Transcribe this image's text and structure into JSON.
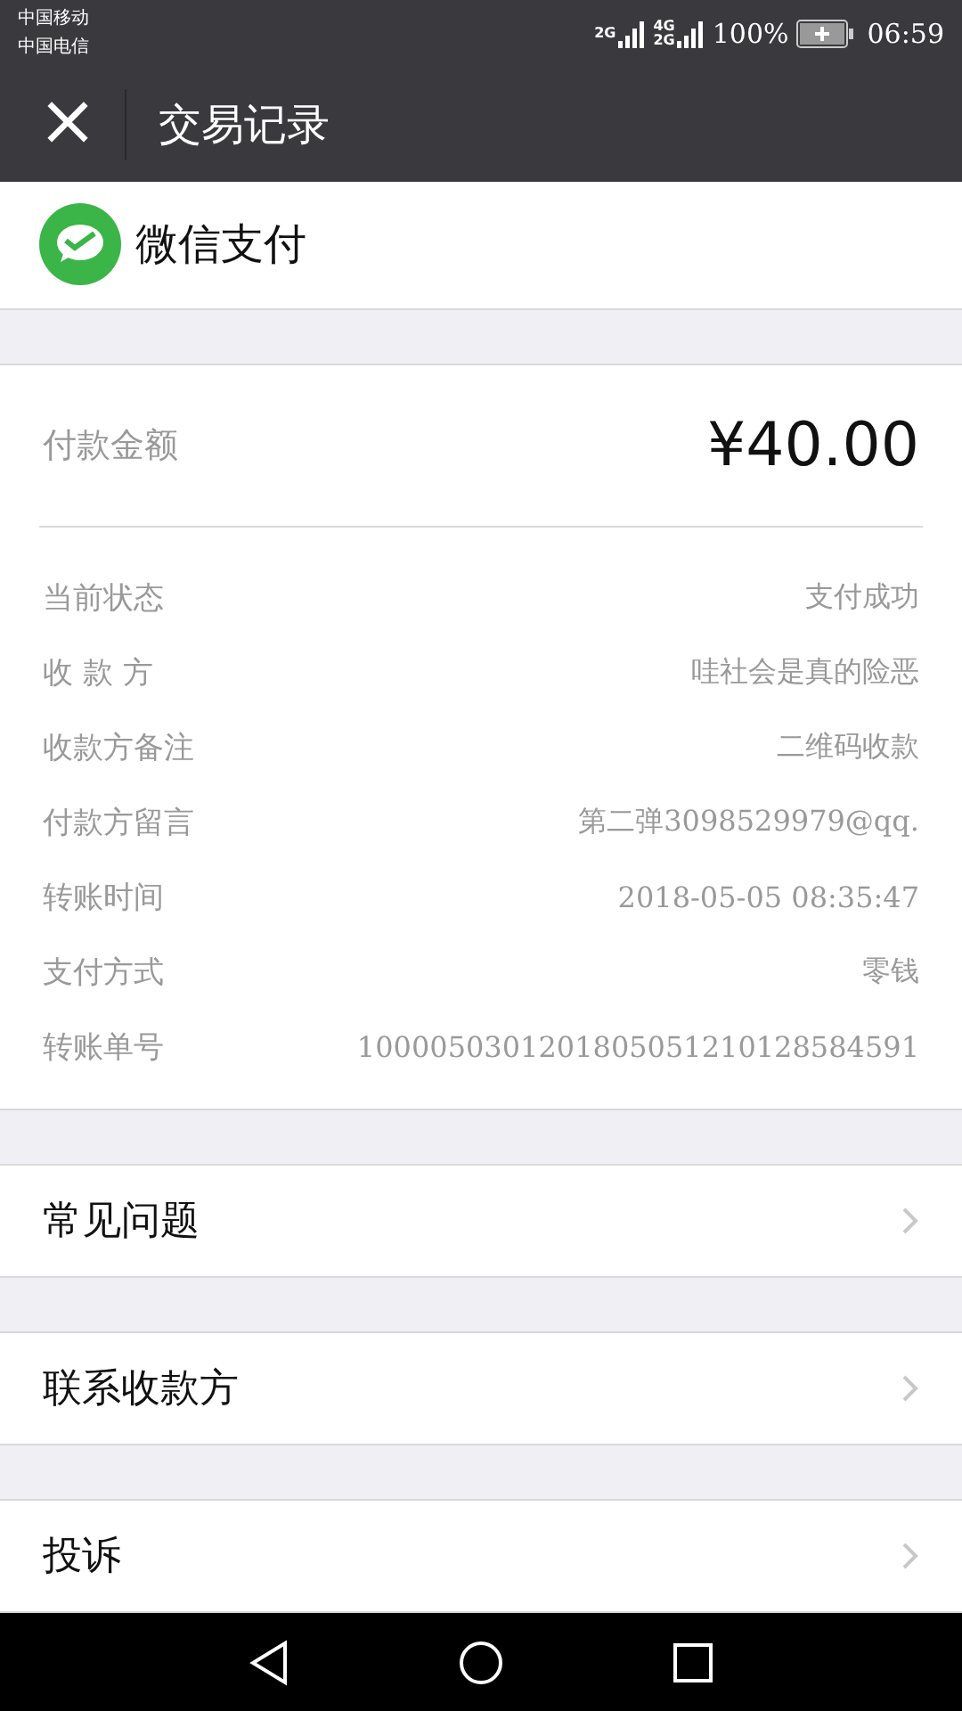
{
  "status_bar": {
    "carriers": [
      "中国移动",
      "中国电信"
    ],
    "signals": [
      {
        "labels": [
          "2G"
        ]
      },
      {
        "labels": [
          "4G",
          "2G"
        ]
      }
    ],
    "battery": "100%",
    "time": "06:59"
  },
  "header": {
    "close": "×",
    "title": "交易记录"
  },
  "brand": {
    "name": "微信支付"
  },
  "payment": {
    "amount_label": "付款金额",
    "amount": "¥40.00",
    "details": [
      {
        "label": "当前状态",
        "value": "支付成功"
      },
      {
        "label": "收 款 方",
        "value": "哇社会是真的险恶"
      },
      {
        "label": "收款方备注",
        "value": "二维码收款"
      },
      {
        "label": "付款方留言",
        "value": "第二弹3098529979@qq."
      },
      {
        "label": "转账时间",
        "value": "2018-05-05 08:35:47"
      },
      {
        "label": "支付方式",
        "value": "零钱"
      },
      {
        "label": "转账单号",
        "value": "1000050301201805051210128584591"
      }
    ]
  },
  "menu": [
    {
      "label": "常见问题"
    },
    {
      "label": "联系收款方"
    },
    {
      "label": "投诉"
    }
  ]
}
